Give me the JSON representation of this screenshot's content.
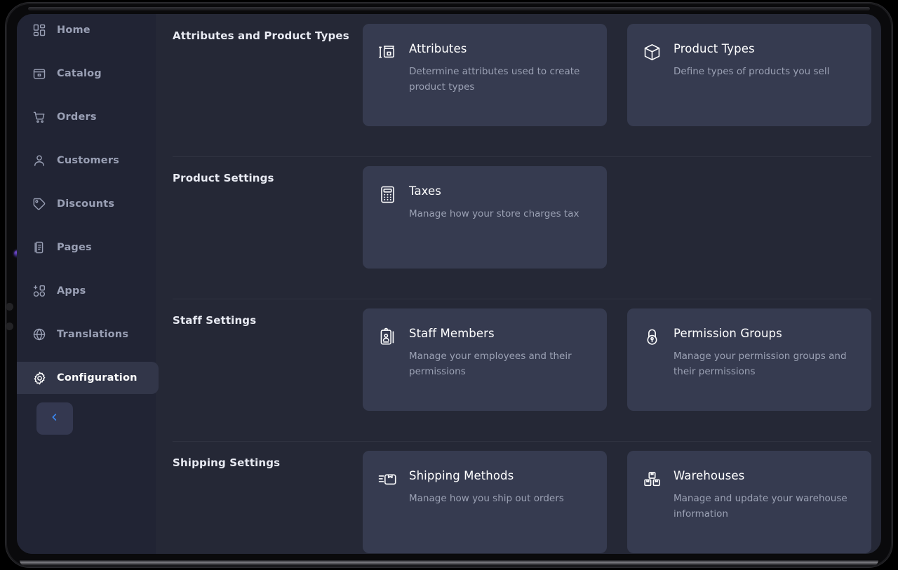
{
  "theme": {
    "screen_bg": "#252836",
    "sidebar_bg": "#212434",
    "card_bg": "#363b50",
    "active_nav_bg": "#323649",
    "accent_blue": "#3b87f0",
    "title_color": "#ffffff",
    "muted_color": "#9ba1b4"
  },
  "sidebar": {
    "items": [
      {
        "label": "Home",
        "icon": "dashboard-icon",
        "active": false
      },
      {
        "label": "Catalog",
        "icon": "catalog-box-icon",
        "active": false
      },
      {
        "label": "Orders",
        "icon": "shopping-cart-icon",
        "active": false
      },
      {
        "label": "Customers",
        "icon": "person-icon",
        "active": false
      },
      {
        "label": "Discounts",
        "icon": "tag-icon",
        "active": false
      },
      {
        "label": "Pages",
        "icon": "document-icon",
        "active": false
      },
      {
        "label": "Apps",
        "icon": "apps-plus-icon",
        "active": false
      },
      {
        "label": "Translations",
        "icon": "globe-icon",
        "active": false
      },
      {
        "label": "Configuration",
        "icon": "gear-icon",
        "active": true
      }
    ],
    "collapse_button": {
      "icon": "chevron-left-icon",
      "aria_label": "Collapse sidebar"
    }
  },
  "sections": [
    {
      "title": "Attributes and Product Types",
      "cards": [
        {
          "title": "Attributes",
          "description": "Determine attributes used to create product types",
          "icon": "attributes-icon"
        },
        {
          "title": "Product Types",
          "description": "Define types of products you sell",
          "icon": "cube-icon"
        }
      ]
    },
    {
      "title": "Product Settings",
      "cards": [
        {
          "title": "Taxes",
          "description": "Manage how your store charges tax",
          "icon": "calculator-icon"
        }
      ]
    },
    {
      "title": "Staff Settings",
      "cards": [
        {
          "title": "Staff Members",
          "description": "Manage your employees and their permissions",
          "icon": "id-badge-icon"
        },
        {
          "title": "Permission Groups",
          "description": "Manage your permission groups and their permissions",
          "icon": "padlock-icon"
        }
      ]
    },
    {
      "title": "Shipping Settings",
      "cards": [
        {
          "title": "Shipping Methods",
          "description": "Manage how you ship out orders",
          "icon": "shipping-package-icon"
        },
        {
          "title": "Warehouses",
          "description": "Manage and update your warehouse information",
          "icon": "warehouse-boxes-icon"
        }
      ]
    }
  ]
}
